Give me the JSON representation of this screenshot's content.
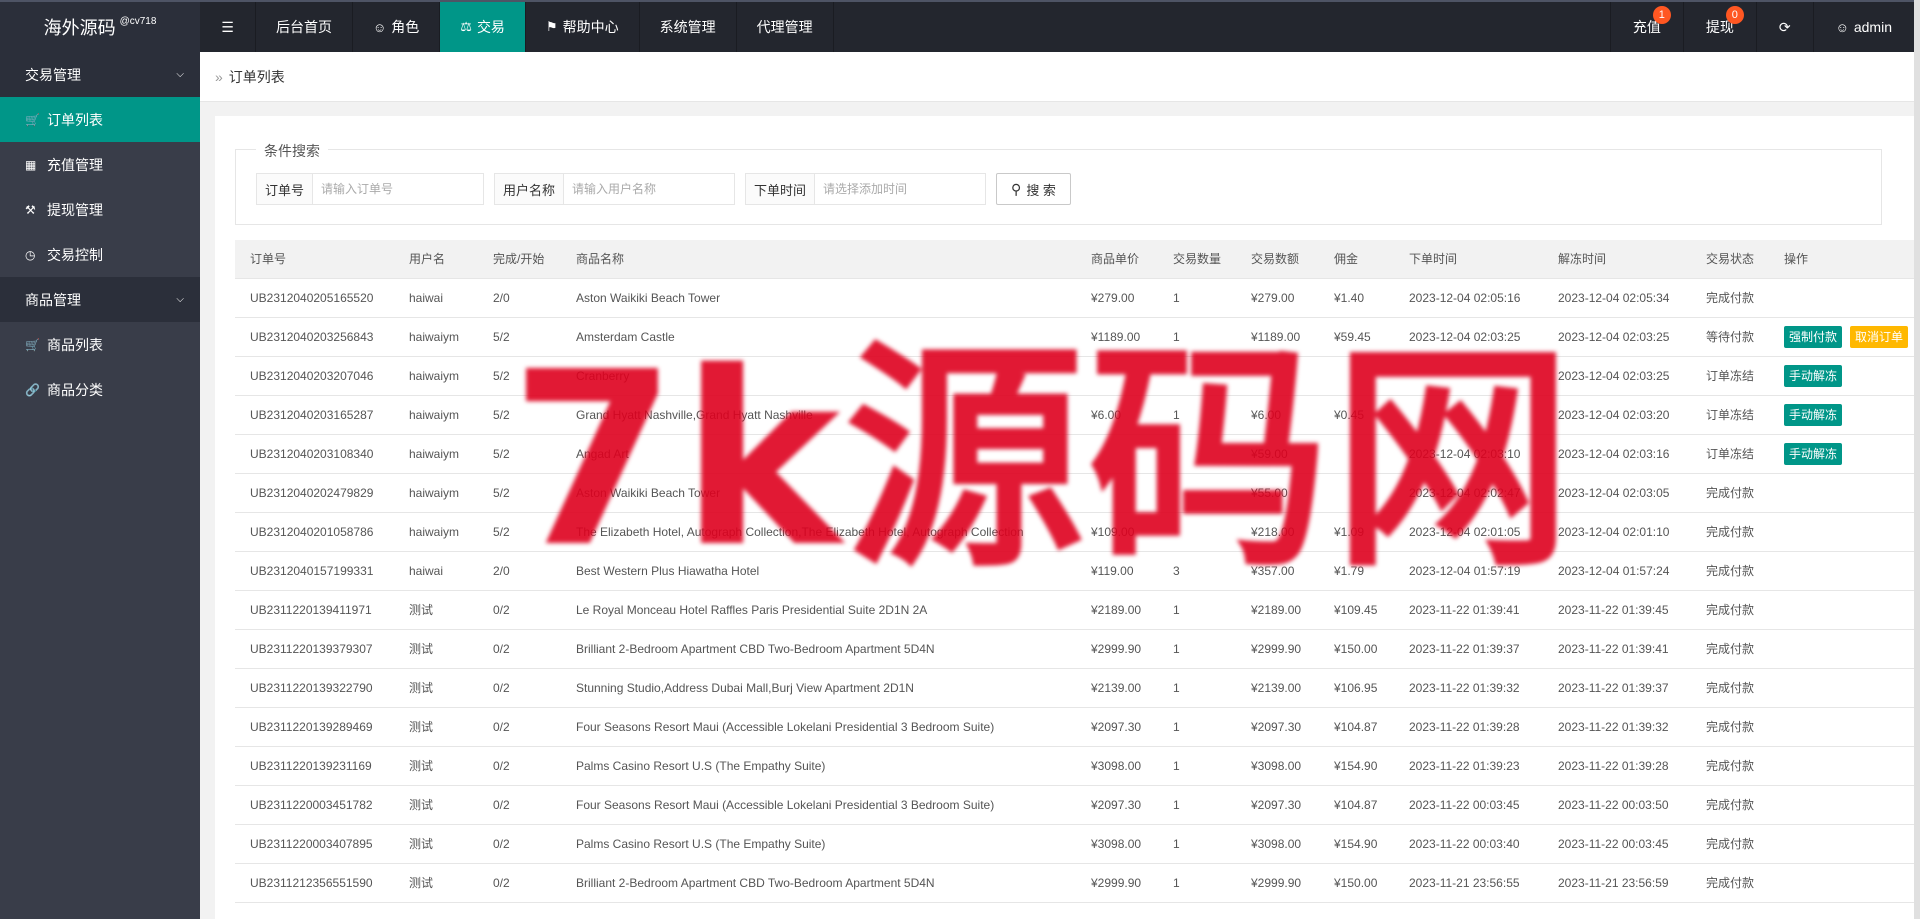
{
  "app": {
    "logo": "海外源码",
    "logo_sup": "@cv718"
  },
  "topnav": {
    "toggle_icon": "menu-fold-icon",
    "items": [
      {
        "label": "后台首页",
        "icon": ""
      },
      {
        "label": "角色",
        "icon": "user-icon"
      },
      {
        "label": "交易",
        "icon": "scale-icon",
        "active": true
      },
      {
        "label": "帮助中心",
        "icon": "flag-icon"
      },
      {
        "label": "系统管理",
        "icon": ""
      },
      {
        "label": "代理管理",
        "icon": ""
      }
    ],
    "right": {
      "recharge": "充值",
      "recharge_badge": "1",
      "withdraw": "提现",
      "withdraw_badge": "0",
      "refresh_icon": "refresh-icon",
      "user": "admin"
    }
  },
  "sidebar": {
    "groups": [
      {
        "label": "交易管理",
        "items": [
          {
            "label": "订单列表",
            "icon": "cart-icon",
            "active": true
          },
          {
            "label": "充值管理",
            "icon": "card-icon"
          },
          {
            "label": "提现管理",
            "icon": "hammer-icon"
          },
          {
            "label": "交易控制",
            "icon": "dashboard-icon"
          }
        ]
      },
      {
        "label": "商品管理",
        "items": [
          {
            "label": "商品列表",
            "icon": "cart-icon"
          },
          {
            "label": "商品分类",
            "icon": "link-icon"
          }
        ]
      }
    ]
  },
  "breadcrumb": {
    "current": "订单列表"
  },
  "search": {
    "legend": "条件搜索",
    "order_label": "订单号",
    "order_placeholder": "请输入订单号",
    "user_label": "用户名称",
    "user_placeholder": "请输入用户名称",
    "time_label": "下单时间",
    "time_placeholder": "请选择添加时间",
    "button": "搜 索"
  },
  "table": {
    "columns": [
      "订单号",
      "用户名",
      "完成/开始",
      "商品名称",
      "商品单价",
      "交易数量",
      "交易数额",
      "佣金",
      "下单时间",
      "解冻时间",
      "交易状态",
      "操作"
    ],
    "rows": [
      [
        "UB2312040205165520",
        "haiwai",
        "2/0",
        "Aston Waikiki Beach Tower",
        "¥279.00",
        "1",
        "¥279.00",
        "¥1.40",
        "2023-12-04 02:05:16",
        "2023-12-04 02:05:34",
        "完成付款",
        ""
      ],
      [
        "UB2312040203256843",
        "haiwaiym",
        "5/2",
        "Amsterdam Castle",
        "¥1189.00",
        "1",
        "¥1189.00",
        "¥59.45",
        "2023-12-04 02:03:25",
        "2023-12-04 02:03:25",
        "等待付款",
        "force"
      ],
      [
        "UB2312040203207046",
        "haiwaiym",
        "5/2",
        "Cranberry",
        "",
        "",
        "",
        "",
        "",
        "2023-12-04 02:03:25",
        "订单冻结",
        "unfreeze"
      ],
      [
        "UB2312040203165287",
        "haiwaiym",
        "5/2",
        "Grand Hyatt Nashville,Grand Hyatt Nashville",
        "¥6.00",
        "1",
        "¥6.00",
        "¥0.45",
        "",
        "2023-12-04 02:03:20",
        "订单冻结",
        "unfreeze"
      ],
      [
        "UB2312040203108340",
        "haiwaiym",
        "5/2",
        "Angad Art",
        "",
        "",
        "¥59.00",
        "",
        "2023-12-04 02:03:10",
        "2023-12-04 02:03:16",
        "订单冻结",
        "unfreeze"
      ],
      [
        "UB2312040202479829",
        "haiwaiym",
        "5/2",
        "Aston Waikiki Beach Tower",
        "",
        "",
        "¥55.00",
        "",
        "2023-12-04 02:02:47",
        "2023-12-04 02:03:05",
        "完成付款",
        ""
      ],
      [
        "UB2312040201058786",
        "haiwaiym",
        "5/2",
        "The Elizabeth Hotel, Autograph Collection,The Elizabeth Hotel, Autograph Collection",
        "¥109.00",
        "",
        "¥218.00",
        "¥1.09",
        "2023-12-04 02:01:05",
        "2023-12-04 02:01:10",
        "完成付款",
        ""
      ],
      [
        "UB2312040157199331",
        "haiwai",
        "2/0",
        "Best Western Plus Hiawatha Hotel",
        "¥119.00",
        "3",
        "¥357.00",
        "¥1.79",
        "2023-12-04 01:57:19",
        "2023-12-04 01:57:24",
        "完成付款",
        ""
      ],
      [
        "UB2311220139411971",
        "测试",
        "0/2",
        "Le Royal Monceau Hotel Raffles Paris Presidential Suite 2D1N 2A",
        "¥2189.00",
        "1",
        "¥2189.00",
        "¥109.45",
        "2023-11-22 01:39:41",
        "2023-11-22 01:39:45",
        "完成付款",
        ""
      ],
      [
        "UB2311220139379307",
        "测试",
        "0/2",
        "Brilliant 2-Bedroom Apartment CBD Two-Bedroom Apartment 5D4N",
        "¥2999.90",
        "1",
        "¥2999.90",
        "¥150.00",
        "2023-11-22 01:39:37",
        "2023-11-22 01:39:41",
        "完成付款",
        ""
      ],
      [
        "UB2311220139322790",
        "测试",
        "0/2",
        "Stunning Studio,Address Dubai Mall,Burj View Apartment 2D1N",
        "¥2139.00",
        "1",
        "¥2139.00",
        "¥106.95",
        "2023-11-22 01:39:32",
        "2023-11-22 01:39:37",
        "完成付款",
        ""
      ],
      [
        "UB2311220139289469",
        "测试",
        "0/2",
        "Four Seasons Resort Maui (Accessible Lokelani Presidential 3 Bedroom Suite)",
        "¥2097.30",
        "1",
        "¥2097.30",
        "¥104.87",
        "2023-11-22 01:39:28",
        "2023-11-22 01:39:32",
        "完成付款",
        ""
      ],
      [
        "UB2311220139231169",
        "测试",
        "0/2",
        "Palms Casino Resort U.S (The Empathy Suite)",
        "¥3098.00",
        "1",
        "¥3098.00",
        "¥154.90",
        "2023-11-22 01:39:23",
        "2023-11-22 01:39:28",
        "完成付款",
        ""
      ],
      [
        "UB2311220003451782",
        "测试",
        "0/2",
        "Four Seasons Resort Maui (Accessible Lokelani Presidential 3 Bedroom Suite)",
        "¥2097.30",
        "1",
        "¥2097.30",
        "¥104.87",
        "2023-11-22 00:03:45",
        "2023-11-22 00:03:50",
        "完成付款",
        ""
      ],
      [
        "UB2311220003407895",
        "测试",
        "0/2",
        "Palms Casino Resort U.S (The Empathy Suite)",
        "¥3098.00",
        "1",
        "¥3098.00",
        "¥154.90",
        "2023-11-22 00:03:40",
        "2023-11-22 00:03:45",
        "完成付款",
        ""
      ],
      [
        "UB2311212356551590",
        "测试",
        "0/2",
        "Brilliant 2-Bedroom Apartment CBD Two-Bedroom Apartment 5D4N",
        "¥2999.90",
        "1",
        "¥2999.90",
        "¥150.00",
        "2023-11-21 23:56:55",
        "2023-11-21 23:56:59",
        "完成付款",
        ""
      ]
    ],
    "op_force": "强制付款",
    "op_cancel": "取消订单",
    "op_unfreeze": "手动解冻"
  },
  "watermark": "7k源码网",
  "colors": {
    "topbar": "#23262e",
    "sidebar": "#393d49",
    "accent": "#009688",
    "warn": "#ffb800",
    "badge": "#ff5722",
    "watermark": "#de001e"
  }
}
